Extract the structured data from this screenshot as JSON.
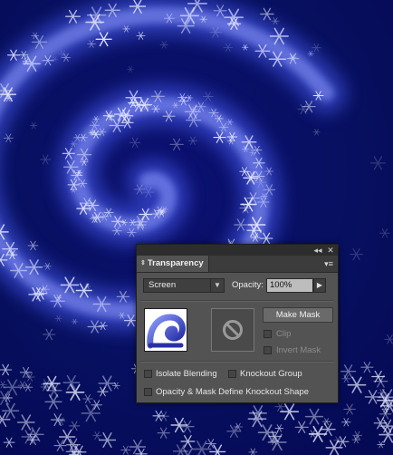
{
  "panel": {
    "collapse_icon": "double-chevron-left-icon",
    "close_icon": "close-icon",
    "tab_label": "Transparency",
    "tab_arrows_icon": "up-down-arrows-icon",
    "menu_icon": "panel-menu-icon",
    "blend_mode": "Screen",
    "opacity_label": "Opacity:",
    "opacity_value": "100%",
    "make_mask_label": "Make Mask",
    "clip_label": "Clip",
    "invert_mask_label": "Invert Mask",
    "isolate_blending_label": "Isolate Blending",
    "knockout_group_label": "Knockout Group",
    "opacity_mask_label": "Opacity & Mask Define Knockout Shape",
    "colors": {
      "panel_bg": "#535353",
      "titlebar_bg": "#2d2d2d",
      "field_bg": "#bdbdbd",
      "art_background": "#050a55",
      "spiral_glow": "#6b7cff"
    }
  }
}
